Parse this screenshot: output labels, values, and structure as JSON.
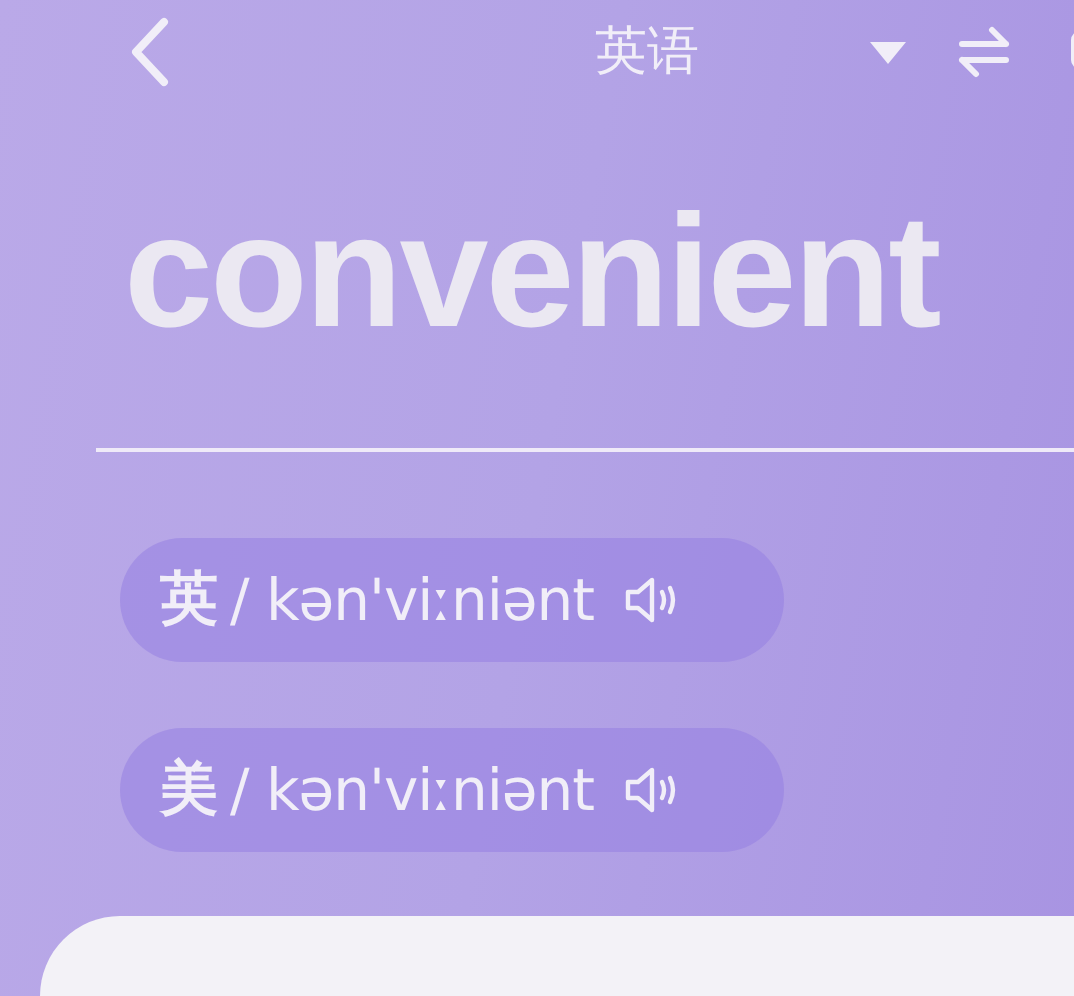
{
  "header": {
    "title": "英语"
  },
  "word": "convenient",
  "pronunciations": [
    {
      "region": "英",
      "phonetic": "/ kən'viːniənt"
    },
    {
      "region": "美",
      "phonetic": "/ kən'viːniənt"
    }
  ]
}
